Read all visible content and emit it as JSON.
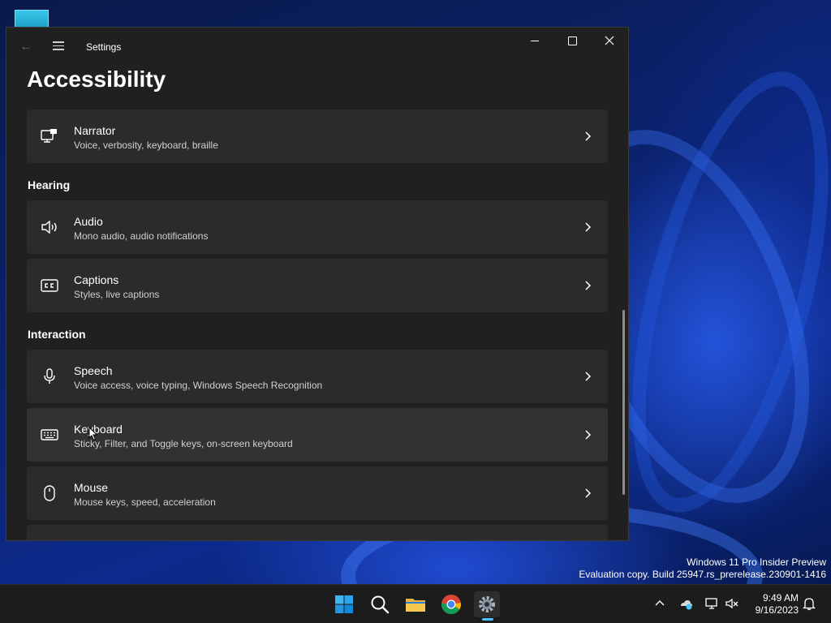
{
  "window": {
    "title": "Settings",
    "page_title": "Accessibility"
  },
  "cards_top": [
    {
      "label": "Narrator",
      "desc": "Voice, verbosity, keyboard, braille",
      "icon": "narrator-icon"
    }
  ],
  "sections": {
    "hearing": "Hearing",
    "interaction": "Interaction"
  },
  "hearing_items": [
    {
      "label": "Audio",
      "desc": "Mono audio, audio notifications",
      "icon": "speaker-icon"
    },
    {
      "label": "Captions",
      "desc": "Styles, live captions",
      "icon": "captions-icon"
    }
  ],
  "interaction_items": [
    {
      "label": "Speech",
      "desc": "Voice access, voice typing, Windows Speech Recognition",
      "icon": "microphone-icon"
    },
    {
      "label": "Keyboard",
      "desc": "Sticky, Filter, and Toggle keys, on-screen keyboard",
      "icon": "keyboard-icon"
    },
    {
      "label": "Mouse",
      "desc": "Mouse keys, speed, acceleration",
      "icon": "mouse-icon"
    }
  ],
  "watermark": {
    "line1": "Windows 11 Pro Insider Preview",
    "line2": "Evaluation copy. Build 25947.rs_prerelease.230901-1416"
  },
  "clock": {
    "time": "9:49 AM",
    "date": "9/16/2023"
  },
  "colors": {
    "accent": "#4cc2ff",
    "window_bg": "#202020",
    "card_bg": "#2b2b2b"
  }
}
